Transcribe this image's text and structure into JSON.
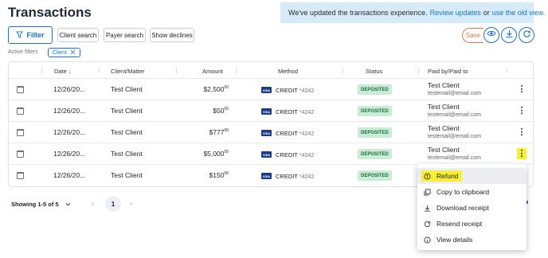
{
  "page_title": "Transactions",
  "banner": {
    "text": "We've updated the transactions experience.",
    "review_link": "Review updates",
    "or_text": "or",
    "old_view_link": "use the old view."
  },
  "toolbar": {
    "filter_label": "Filter",
    "client_search": "Client search",
    "payer_search": "Payer search",
    "show_declines": "Show declines",
    "save_label": "Save"
  },
  "active_filters": {
    "label": "Active filters",
    "chips": [
      {
        "label": "Client"
      }
    ]
  },
  "table": {
    "columns": [
      "Date",
      "Client/Matter",
      "Amount",
      "Method",
      "Status",
      "Paid by/Paid to"
    ],
    "rows": [
      {
        "date": "12/26/20...",
        "client": "Test Client",
        "amount": "$2,500",
        "cents": "00",
        "method": "CREDIT",
        "last4": "*4242",
        "status": "DEPOSITED",
        "payee": "Test Client",
        "email": "testemail@email.com"
      },
      {
        "date": "12/26/20...",
        "client": "Test Client",
        "amount": "$50",
        "cents": "00",
        "method": "CREDIT",
        "last4": "*4242",
        "status": "DEPOSITED",
        "payee": "Test Client",
        "email": "testemail@email.com"
      },
      {
        "date": "12/26/20...",
        "client": "Test Client",
        "amount": "$777",
        "cents": "00",
        "method": "CREDIT",
        "last4": "*4242",
        "status": "DEPOSITED",
        "payee": "Test Client",
        "email": "testemail@email.com"
      },
      {
        "date": "12/26/20...",
        "client": "Test Client",
        "amount": "$5,000",
        "cents": "00",
        "method": "CREDIT",
        "last4": "*4242",
        "status": "DEPOSITED",
        "payee": "Test Client",
        "email": "testemail@email.com"
      },
      {
        "date": "12/26/20...",
        "client": "Test Client",
        "amount": "$150",
        "cents": "00",
        "method": "CREDIT",
        "last4": "*4242",
        "status": "DEPOSITED",
        "payee": "",
        "email": ""
      }
    ]
  },
  "pagination": {
    "showing": "Showing 1-5 of 5",
    "current_page": "1"
  },
  "context_menu": {
    "items": [
      "Refund",
      "Copy to clipboard",
      "Download receipt",
      "Resend receipt",
      "View details"
    ]
  },
  "colors": {
    "accent": "#1a73c8",
    "save": "#e0764a",
    "highlight": "#f7f034",
    "deposited_bg": "#c9ecd7"
  }
}
